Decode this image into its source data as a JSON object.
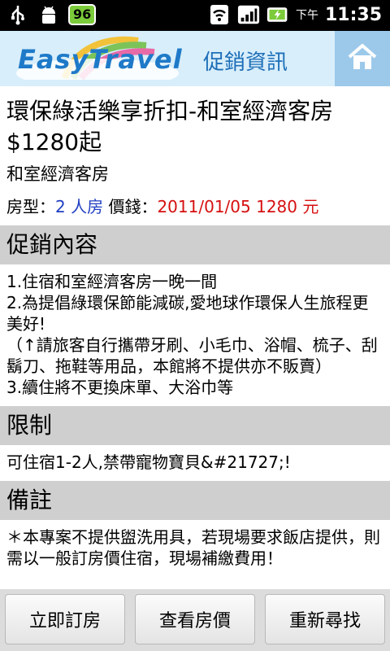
{
  "status_bar": {
    "battery_badge": "96",
    "ampm": "下午",
    "time": "11:35"
  },
  "header": {
    "logo": "EasyTravel",
    "title": "促銷資訊"
  },
  "promo": {
    "title": "環保綠活樂享折扣-和室經濟客房$1280起",
    "room_name": "和室經濟客房",
    "room_type_label": "房型：",
    "room_type_value": "2 人房",
    "price_label": "價錢：",
    "price_date": "2011/01/05",
    "price_value": "1280 元"
  },
  "sections": {
    "content_header": "促銷內容",
    "content_body": "1.住宿和室經濟客房一晚一間\n2.為提倡綠環保節能減碳,愛地球作環保人生旅程更美好!\n（↑請旅客自行攜帶牙刷、小毛巾、浴帽、梳子、刮鬍刀、拖鞋等用品，本館將不提供亦不販賣）\n3.續住將不更換床單、大浴巾等",
    "limit_header": "限制",
    "limit_body": "可住宿1-2人,禁帶寵物寶貝&#21727;!",
    "note_header": "備註",
    "note_body": "＊本專案不提供盥洗用具，若現場要求飯店提供，則需以一般訂房價住宿，現場補繳費用！"
  },
  "buttons": {
    "book": "立即訂房",
    "view_price": "查看房價",
    "search_again": "重新尋找"
  }
}
